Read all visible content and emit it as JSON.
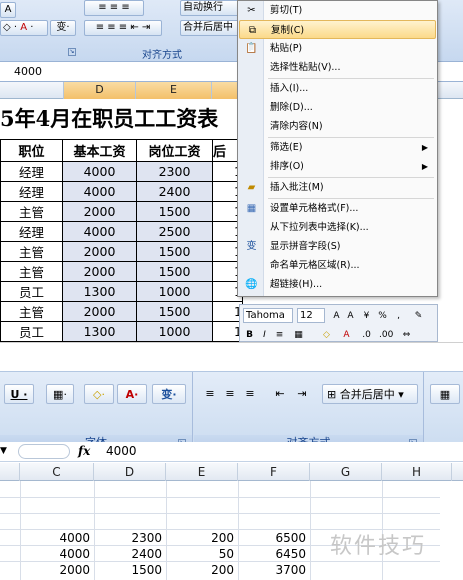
{
  "top": {
    "ribbon": {
      "btn_autowrap": "自动换行",
      "btn_merge": "合并后居中",
      "group_align": "对齐方式"
    },
    "formula_value": "4000",
    "col_headers": [
      "D",
      "E"
    ],
    "title": "5年4月在职员工工资表",
    "headers": [
      "职位",
      "基本工资",
      "岗位工资",
      "后"
    ],
    "rows": [
      [
        "经理",
        "4000",
        "2300",
        "1"
      ],
      [
        "经理",
        "4000",
        "2400",
        "1"
      ],
      [
        "主管",
        "2000",
        "1500",
        "1"
      ],
      [
        "经理",
        "4000",
        "2500",
        "1"
      ],
      [
        "主管",
        "2000",
        "1500",
        "1"
      ],
      [
        "主管",
        "2000",
        "1500",
        "1"
      ],
      [
        "员工",
        "1300",
        "1000",
        "1"
      ],
      [
        "主管",
        "2000",
        "1500",
        "1"
      ],
      [
        "员工",
        "1300",
        "1000",
        "1"
      ]
    ],
    "context_menu": {
      "items": [
        {
          "label": "剪切(T)",
          "icon": "scissors-icon"
        },
        {
          "label": "复制(C)",
          "icon": "copy-icon"
        },
        {
          "label": "粘贴(P)",
          "icon": "paste-icon"
        },
        {
          "label": "选择性粘贴(V)...",
          "icon": ""
        },
        {
          "label": "插入(I)...",
          "icon": ""
        },
        {
          "label": "删除(D)...",
          "icon": ""
        },
        {
          "label": "清除内容(N)",
          "icon": ""
        },
        {
          "label": "筛选(E)",
          "icon": ""
        },
        {
          "label": "排序(O)",
          "icon": ""
        },
        {
          "label": "插入批注(M)",
          "icon": "comment-icon"
        },
        {
          "label": "设置单元格格式(F)...",
          "icon": "format-cells-icon"
        },
        {
          "label": "从下拉列表中选择(K)...",
          "icon": ""
        },
        {
          "label": "显示拼音字段(S)",
          "icon": "phonetic-icon"
        },
        {
          "label": "命名单元格区域(R)...",
          "icon": ""
        },
        {
          "label": "超链接(H)...",
          "icon": "hyperlink-icon"
        }
      ]
    },
    "mini_toolbar": {
      "font": "Tahoma",
      "size": "12"
    }
  },
  "bottom": {
    "group_font": "字体",
    "group_align": "对齐方式",
    "merge_label": "合并后居中",
    "formula_value": "4000",
    "col_headers": [
      "C",
      "D",
      "E",
      "F",
      "G",
      "H"
    ],
    "rows": [
      [
        "4000",
        "2300",
        "200",
        "6500"
      ],
      [
        "4000",
        "2400",
        "50",
        "6450"
      ],
      [
        "2000",
        "1500",
        "200",
        "3700"
      ]
    ]
  },
  "watermark": "软件技巧"
}
